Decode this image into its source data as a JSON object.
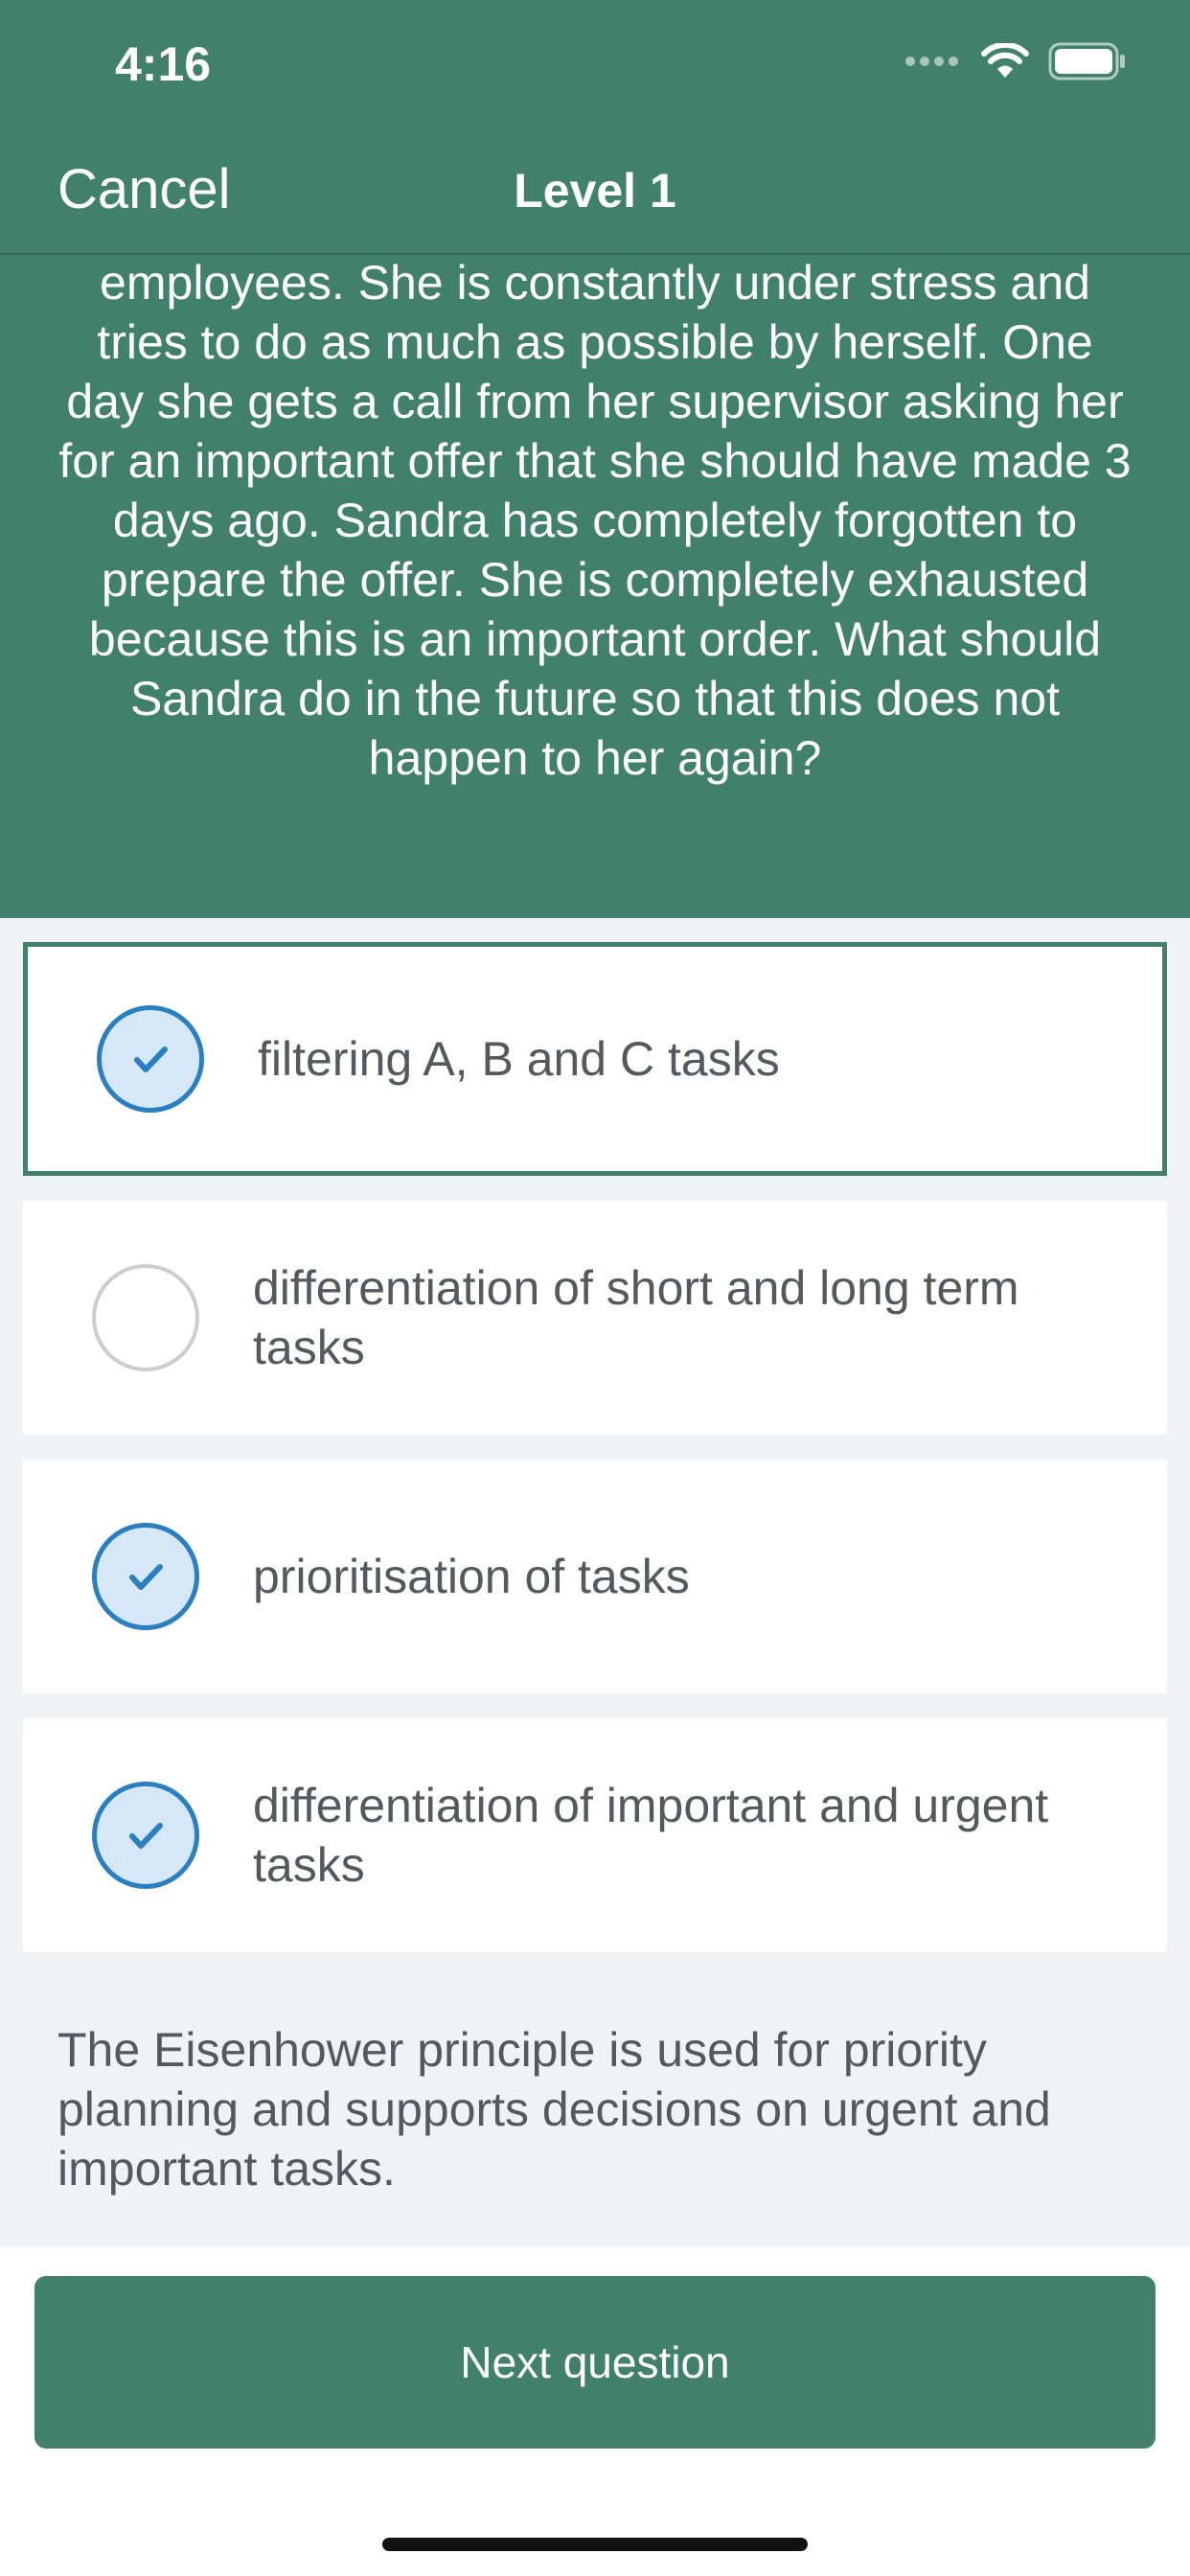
{
  "status_bar": {
    "time": "4:16"
  },
  "nav": {
    "cancel_label": "Cancel",
    "title": "Level 1"
  },
  "question": {
    "text": "employees. She is constantly under stress and tries to do as much as possible by herself. One day she gets a call from her supervisor asking her for an important offer that she should have made 3 days ago. Sandra has completely forgotten to prepare the offer. She is completely exhausted because this is an important order. What should Sandra do in the future so that this does not happen to her again?"
  },
  "answers": [
    {
      "label": "filtering A, B and C tasks",
      "checked": true,
      "highlighted": true
    },
    {
      "label": "differentiation of short and long term tasks",
      "checked": false,
      "highlighted": false
    },
    {
      "label": "prioritisation of tasks",
      "checked": true,
      "highlighted": false
    },
    {
      "label": "differentiation of important and urgent tasks",
      "checked": true,
      "highlighted": false
    }
  ],
  "explanation": "The Eisenhower principle is used for priority planning and supports decisions on urgent and important tasks.",
  "footer": {
    "next_label": "Next question"
  },
  "colors": {
    "primary": "#41806a",
    "check_blue": "#2a7fc0",
    "check_fill": "#d6e8f8",
    "text_gray": "#55595e",
    "background": "#f0f3f6"
  },
  "icons": {
    "wifi": "wifi-icon",
    "battery": "battery-icon",
    "signal": "signal-icon",
    "check": "check-icon"
  }
}
